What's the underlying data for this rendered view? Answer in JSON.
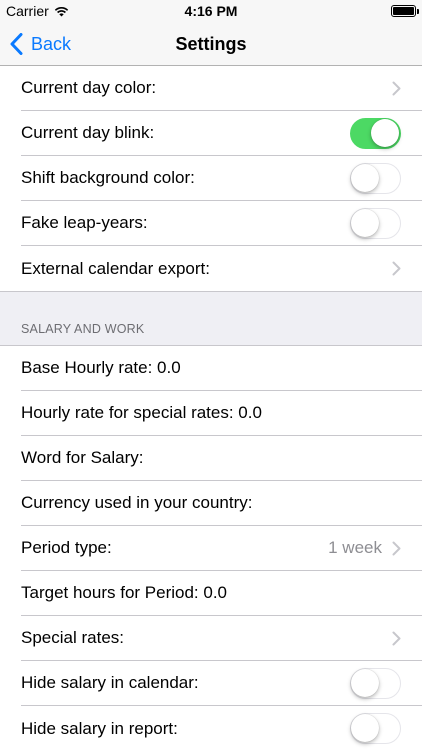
{
  "status_bar": {
    "carrier": "Carrier",
    "time": "4:16 PM",
    "wifi_icon": "wifi-icon",
    "battery_icon": "battery-icon"
  },
  "nav": {
    "back_label": "Back",
    "back_icon": "chevron-left-icon",
    "title": "Settings"
  },
  "colors": {
    "accent": "#0a7aff",
    "toggle_on": "#4cd964",
    "group_background": "#efeff4"
  },
  "general_group": [
    {
      "label": "Current day color:",
      "type": "disclosure"
    },
    {
      "label": "Current day blink:",
      "type": "toggle",
      "on": true
    },
    {
      "label": "Shift background color:",
      "type": "toggle",
      "on": false
    },
    {
      "label": "Fake leap-years:",
      "type": "toggle",
      "on": false
    },
    {
      "label": "External calendar export:",
      "type": "disclosure"
    }
  ],
  "salary_section": {
    "header": "SALARY AND WORK",
    "items": [
      {
        "label": "Base Hourly rate: 0.0",
        "type": "text"
      },
      {
        "label": "Hourly rate for special rates: 0.0",
        "type": "text"
      },
      {
        "label": "Word for Salary:",
        "type": "text"
      },
      {
        "label": "Currency used in your country:",
        "type": "text"
      },
      {
        "label": "Period type:",
        "type": "disclosure",
        "detail": "1 week"
      },
      {
        "label": "Target hours for Period: 0.0",
        "type": "text"
      },
      {
        "label": "Special rates:",
        "type": "disclosure"
      },
      {
        "label": "Hide salary in calendar:",
        "type": "toggle",
        "on": false
      },
      {
        "label": "Hide salary in report:",
        "type": "toggle",
        "on": false
      }
    ]
  }
}
